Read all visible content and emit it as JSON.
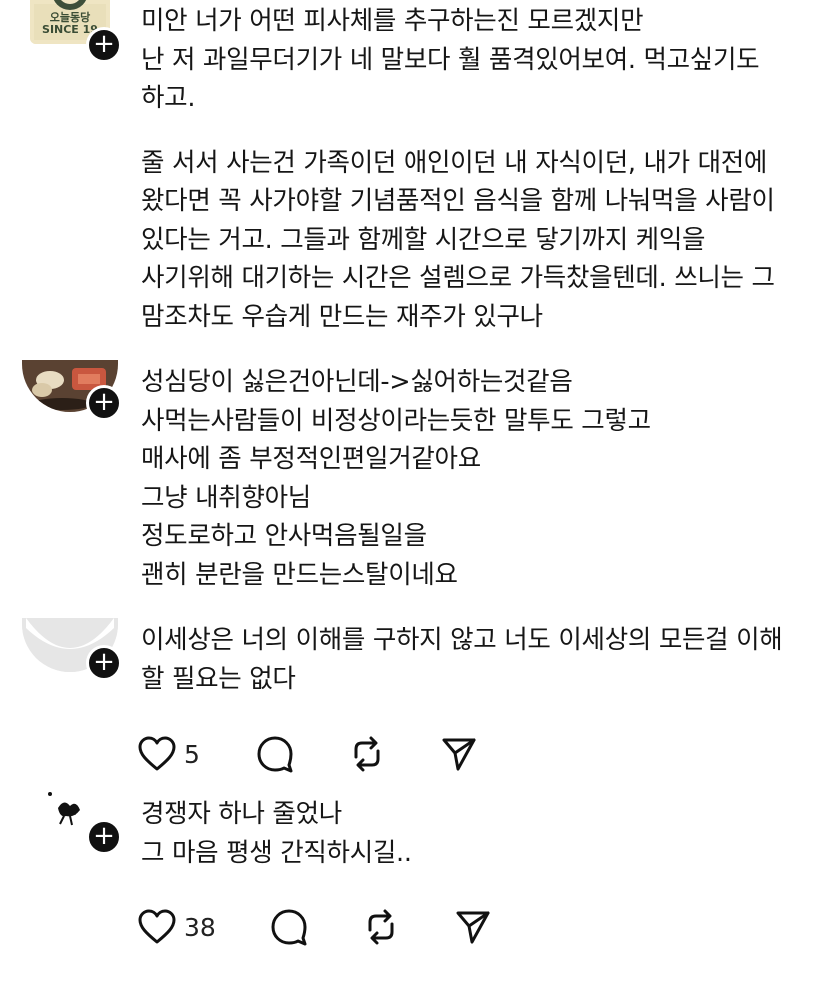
{
  "comments": [
    {
      "avatar_label": "오늘동당 SINCE 19",
      "lines": [
        "미안 너가 어떤 피사체를 추구하는진 모르겠지만",
        "난 저 과일무더기가 네 말보다 훨 품격있어보여. 먹고싶기도",
        "하고."
      ],
      "lines2": [
        "줄 서서 사는건 가족이던 애인이던 내 자식이던, 내가 대전에",
        "왔다면 꼭 사가야할 기념품적인 음식을 함께 나눠먹을 사람이",
        "있다는 거고. 그들과 함께할 시간으로 닿기까지 케익을",
        "사기위해 대기하는 시간은 설렘으로 가득찼을텐데. 쓰니는 그",
        "맘조차도 우습게 만드는 재주가 있구나"
      ]
    },
    {
      "lines": [
        "성심당이 싫은건아닌데->싫어하는것같음",
        "사먹는사람들이 비정상이라는듯한 말투도 그렇고",
        "매사에 좀 부정적인편일거같아요",
        "그냥 내취향아님",
        "정도로하고 안사먹음될일을",
        "괜히 분란을 만드는스탈이네요"
      ]
    },
    {
      "lines": [
        "이세상은 너의 이해를 구하지 않고 너도 이세상의 모든걸 이해",
        "할 필요는 없다"
      ],
      "likes": "5"
    },
    {
      "lines": [
        "경쟁자 하나 줄었나",
        "그 마음 평생 간직하시길.."
      ],
      "likes": "38"
    }
  ],
  "follow_glyph": "+",
  "icons": [
    "heart-icon",
    "comment-icon",
    "repost-icon",
    "share-icon"
  ]
}
